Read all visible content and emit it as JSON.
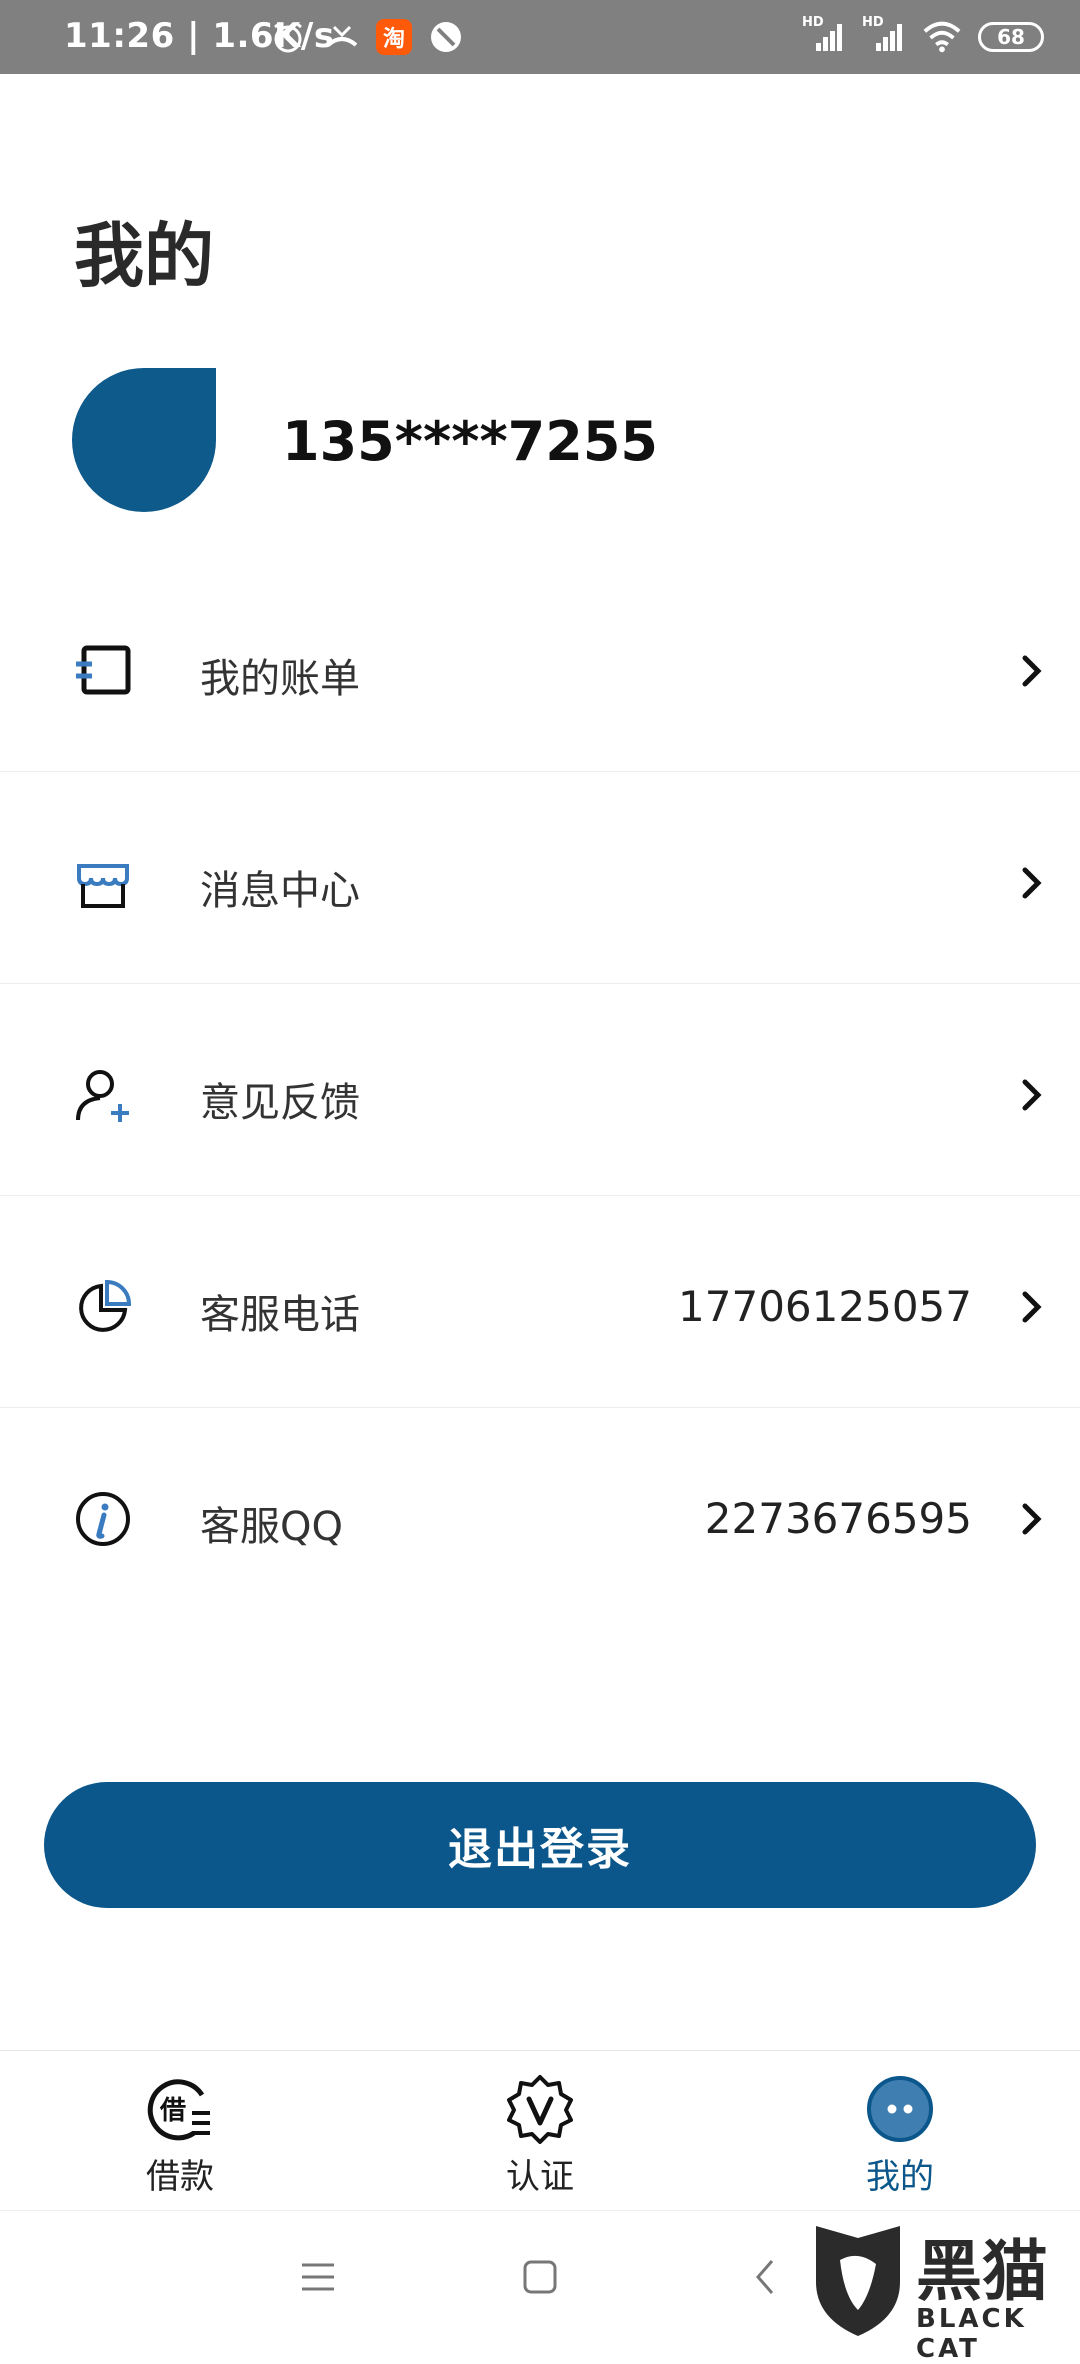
{
  "status_bar": {
    "time_speed": "11:26 | 1.6K/s",
    "taobao_label": "淘",
    "signal_1": "HD",
    "signal_2": "HD",
    "battery": "68"
  },
  "page": {
    "title": "我的",
    "phone_masked": "135****7255"
  },
  "menu": {
    "items": [
      {
        "label": "我的账单",
        "value": "",
        "icon": "bill-icon"
      },
      {
        "label": "消息中心",
        "value": "",
        "icon": "store-message-icon"
      },
      {
        "label": "意见反馈",
        "value": "",
        "icon": "user-add-icon"
      },
      {
        "label": "客服电话",
        "value": "17706125057",
        "icon": "pie-chart-icon"
      },
      {
        "label": "客服QQ",
        "value": "2273676595",
        "icon": "info-icon"
      }
    ]
  },
  "logout": {
    "label": "退出登录"
  },
  "tab_bar": {
    "tabs": [
      {
        "label": "借款",
        "icon": "loan-icon",
        "active": false
      },
      {
        "label": "认证",
        "icon": "verify-badge-icon",
        "active": false
      },
      {
        "label": "我的",
        "icon": "profile-dots-icon",
        "active": true
      }
    ]
  },
  "watermark": {
    "cn": "黑猫",
    "en": "BLACK CAT"
  },
  "colors": {
    "accent": "#0b568a",
    "status_bar": "#808080"
  }
}
